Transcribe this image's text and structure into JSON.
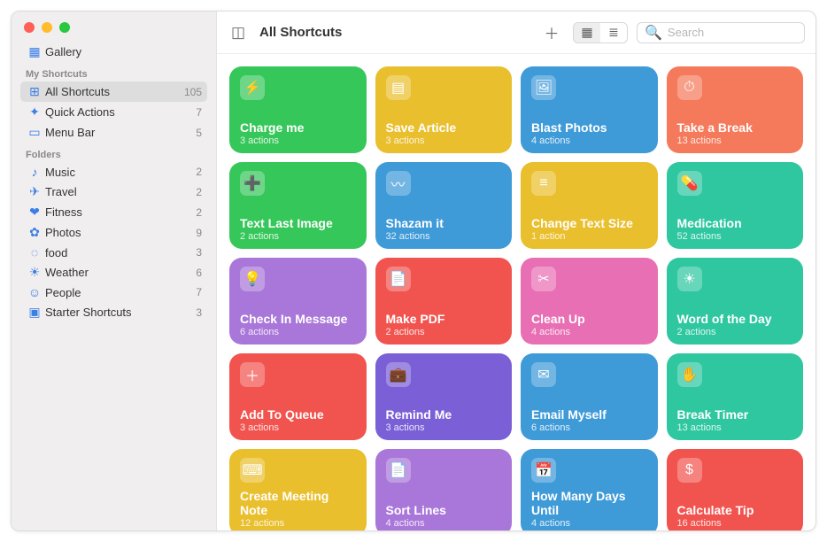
{
  "sidebar": {
    "gallery": {
      "label": "Gallery"
    },
    "section1_title": "My Shortcuts",
    "section1": [
      {
        "icon": "⊞",
        "label": "All Shortcuts",
        "count": "105",
        "selected": true
      },
      {
        "icon": "✦",
        "label": "Quick Actions",
        "count": "7"
      },
      {
        "icon": "▭",
        "label": "Menu Bar",
        "count": "5"
      }
    ],
    "section2_title": "Folders",
    "section2": [
      {
        "icon": "♪",
        "label": "Music",
        "count": "2"
      },
      {
        "icon": "✈",
        "label": "Travel",
        "count": "2"
      },
      {
        "icon": "❤",
        "label": "Fitness",
        "count": "2"
      },
      {
        "icon": "✿",
        "label": "Photos",
        "count": "9"
      },
      {
        "icon": "◌",
        "label": "food",
        "count": "3"
      },
      {
        "icon": "☀",
        "label": "Weather",
        "count": "6"
      },
      {
        "icon": "☺",
        "label": "People",
        "count": "7"
      },
      {
        "icon": "▣",
        "label": "Starter Shortcuts",
        "count": "3"
      }
    ]
  },
  "toolbar": {
    "title": "All Shortcuts",
    "search_placeholder": "Search"
  },
  "cards": [
    {
      "icon": "⚡",
      "name": "Charge me",
      "sub": "3 actions",
      "color": "#36c75a"
    },
    {
      "icon": "▤",
      "name": "Save Article",
      "sub": "3 actions",
      "color": "#e9bf2d"
    },
    {
      "icon": "🖼",
      "name": "Blast Photos",
      "sub": "4 actions",
      "color": "#3f9ad8"
    },
    {
      "icon": "⏱",
      "name": "Take a Break",
      "sub": "13 actions",
      "color": "#f47a5b"
    },
    {
      "icon": "➕",
      "name": "Text Last Image",
      "sub": "2 actions",
      "color": "#36c75a"
    },
    {
      "icon": "〰",
      "name": "Shazam it",
      "sub": "32 actions",
      "color": "#3f9ad8"
    },
    {
      "icon": "≡",
      "name": "Change Text Size",
      "sub": "1 action",
      "color": "#e9bf2d"
    },
    {
      "icon": "💊",
      "name": "Medication",
      "sub": "52 actions",
      "color": "#2fc7a0"
    },
    {
      "icon": "💡",
      "name": "Check In Message",
      "sub": "6 actions",
      "color": "#a977d9"
    },
    {
      "icon": "📄",
      "name": "Make PDF",
      "sub": "2 actions",
      "color": "#f1544f"
    },
    {
      "icon": "✂",
      "name": "Clean Up",
      "sub": "4 actions",
      "color": "#e96fb4"
    },
    {
      "icon": "☀",
      "name": "Word of the Day",
      "sub": "2 actions",
      "color": "#2fc7a0"
    },
    {
      "icon": "＋",
      "name": "Add To Queue",
      "sub": "3 actions",
      "color": "#f1544f"
    },
    {
      "icon": "💼",
      "name": "Remind Me",
      "sub": "3 actions",
      "color": "#7a5fd6"
    },
    {
      "icon": "✉",
      "name": "Email Myself",
      "sub": "6 actions",
      "color": "#3f9ad8"
    },
    {
      "icon": "✋",
      "name": "Break Timer",
      "sub": "13 actions",
      "color": "#2fc7a0"
    },
    {
      "icon": "⌨",
      "name": "Create Meeting Note",
      "sub": "12 actions",
      "color": "#e9bf2d"
    },
    {
      "icon": "📄",
      "name": "Sort Lines",
      "sub": "4 actions",
      "color": "#a977d9"
    },
    {
      "icon": "📅",
      "name": "How Many Days Until",
      "sub": "4 actions",
      "color": "#3f9ad8"
    },
    {
      "icon": "$",
      "name": "Calculate Tip",
      "sub": "16 actions",
      "color": "#f1544f"
    }
  ]
}
